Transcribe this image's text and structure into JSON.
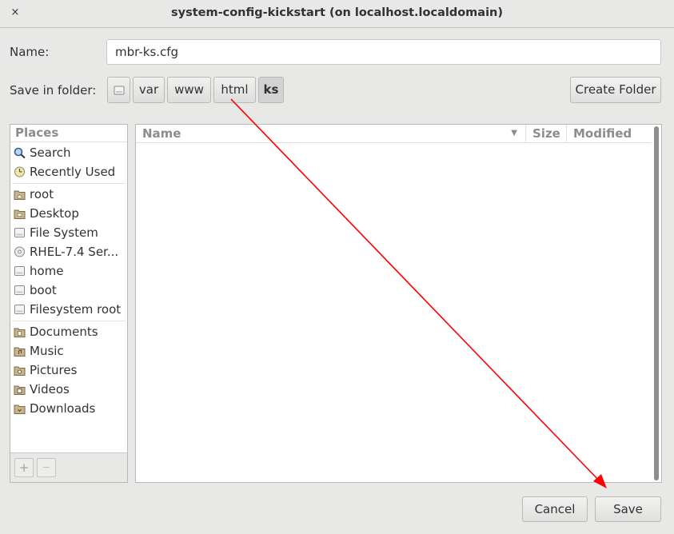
{
  "window": {
    "title": "system-config-kickstart (on localhost.localdomain)",
    "close_glyph": "×"
  },
  "name_label": "Name:",
  "name_value": "mbr-ks.cfg",
  "folder_label": "Save in folder:",
  "path": [
    "var",
    "www",
    "html",
    "ks"
  ],
  "create_folder_label": "Create Folder",
  "places": {
    "header": "Places",
    "groups": [
      [
        {
          "label": "Search",
          "icon": "search-icon"
        },
        {
          "label": "Recently Used",
          "icon": "clock-icon"
        }
      ],
      [
        {
          "label": "root",
          "icon": "home-folder-icon"
        },
        {
          "label": "Desktop",
          "icon": "desktop-folder-icon"
        },
        {
          "label": "File System",
          "icon": "drive-icon"
        },
        {
          "label": "RHEL-7.4 Ser...",
          "icon": "optical-disc-icon"
        },
        {
          "label": "home",
          "icon": "drive-icon"
        },
        {
          "label": "boot",
          "icon": "drive-icon"
        },
        {
          "label": "Filesystem root",
          "icon": "drive-icon"
        }
      ],
      [
        {
          "label": "Documents",
          "icon": "documents-folder-icon"
        },
        {
          "label": "Music",
          "icon": "music-folder-icon"
        },
        {
          "label": "Pictures",
          "icon": "pictures-folder-icon"
        },
        {
          "label": "Videos",
          "icon": "videos-folder-icon"
        },
        {
          "label": "Downloads",
          "icon": "downloads-folder-icon"
        }
      ]
    ],
    "add_glyph": "+",
    "remove_glyph": "—"
  },
  "columns": {
    "name": "Name",
    "size": "Size",
    "modified": "Modified"
  },
  "buttons": {
    "cancel": "Cancel",
    "save": "Save"
  },
  "colors": {
    "annotation_arrow": "#ff0000"
  }
}
